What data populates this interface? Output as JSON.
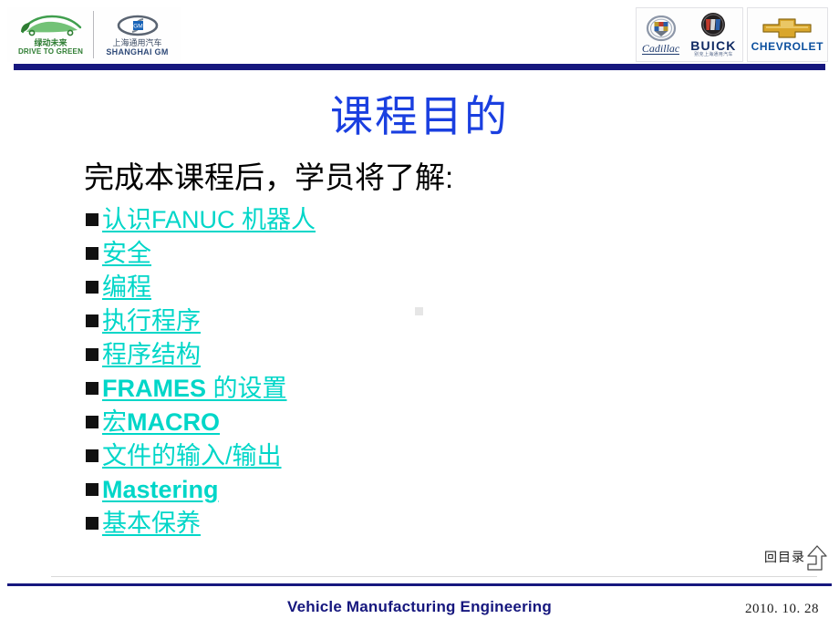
{
  "header": {
    "logos": {
      "drive_to_green": {
        "icon": "green-car-leaf-icon",
        "cn": "绿动未来",
        "en": "DRIVE TO GREEN",
        "color": "#2e7d32"
      },
      "shanghai_gm": {
        "icon": "shanghai-gm-swirl-icon",
        "cn": "上海通用汽车",
        "en": "SHANGHAI GM",
        "color": "#2f4a78"
      },
      "cadillac": {
        "icon": "cadillac-crest-icon",
        "label": "Cadillac",
        "color": "#1e3a6e"
      },
      "buick": {
        "icon": "buick-tri-shield-icon",
        "label": "BUICK",
        "sub": "别克上海通用汽车",
        "color": "#102a63"
      },
      "chevrolet": {
        "icon": "chevrolet-bowtie-icon",
        "label": "CHEVROLET",
        "color": "#0b4f9e"
      }
    },
    "rule_color": "#16177e"
  },
  "slide": {
    "title": "课程目的",
    "title_color": "#1a3fe0",
    "lead_line": "完成本课程后，学员将了解:",
    "link_color": "#00d6c8",
    "bullets": [
      {
        "text": "认识FANUC 机器人",
        "bold_part": ""
      },
      {
        "text": "安全",
        "bold_part": ""
      },
      {
        "text": "编程",
        "bold_part": ""
      },
      {
        "text": "执行程序",
        "bold_part": ""
      },
      {
        "text": "程序结构",
        "bold_part": ""
      },
      {
        "text": "FRAMES 的设置",
        "bold_part": "FRAMES"
      },
      {
        "text": "宏MACRO",
        "bold_part": "MACRO"
      },
      {
        "text": "文件的输入/输出",
        "bold_part": ""
      },
      {
        "text": "Mastering",
        "bold_part": "Mastering"
      },
      {
        "text": "基本保养",
        "bold_part": ""
      }
    ]
  },
  "back_to_contents": {
    "label": "回目录",
    "icon": "up-arrow-outline-icon"
  },
  "footer": {
    "title": "Vehicle Manufacturing Engineering",
    "date": "2010. 10. 28",
    "rule_color": "#16177e"
  }
}
